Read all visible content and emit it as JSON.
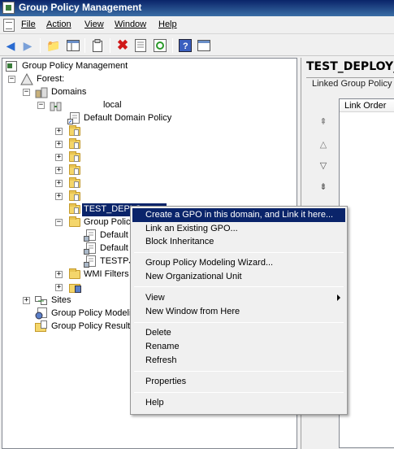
{
  "window": {
    "title": "Group Policy Management"
  },
  "menu": {
    "file": "File",
    "action": "Action",
    "view": "View",
    "window": "Window",
    "help": "Help"
  },
  "toolbar": {
    "icons": [
      "back-arrow-icon",
      "forward-arrow-icon",
      "up-folder-icon",
      "show-hide-tree-icon",
      "clipboard-icon",
      "delete-icon",
      "properties-icon",
      "refresh-icon",
      "help-icon",
      "console-icon"
    ]
  },
  "tree": {
    "root": "Group Policy Management",
    "forest": "Forest:",
    "domains": "Domains",
    "domain": "local",
    "default_domain_policy": "Default Domain Policy",
    "selected_ou": "TEST_DEPLO",
    "group_policy_objects": "Group Policy",
    "gpo_1": "Default I",
    "gpo_2": "Default I",
    "gpo_3": "TESTPJC",
    "wmi_filters": "WMI Filters",
    "sites": "Sites",
    "modeling": "Group Policy Modeling",
    "results": "Group Policy Results"
  },
  "right_pane": {
    "title": "TEST_DEPLOY_",
    "tab_label": "Linked Group Policy (",
    "column_header": "Link Order"
  },
  "context_menu": {
    "items": [
      "Create a GPO in this domain, and Link it here...",
      "Link an Existing GPO...",
      "Block Inheritance",
      "Group Policy Modeling Wizard...",
      "New Organizational Unit",
      "View",
      "New Window from Here",
      "Delete",
      "Rename",
      "Refresh",
      "Properties",
      "Help"
    ]
  },
  "colors": {
    "selection": "#0a246a",
    "title_bar": "#0a246a"
  }
}
